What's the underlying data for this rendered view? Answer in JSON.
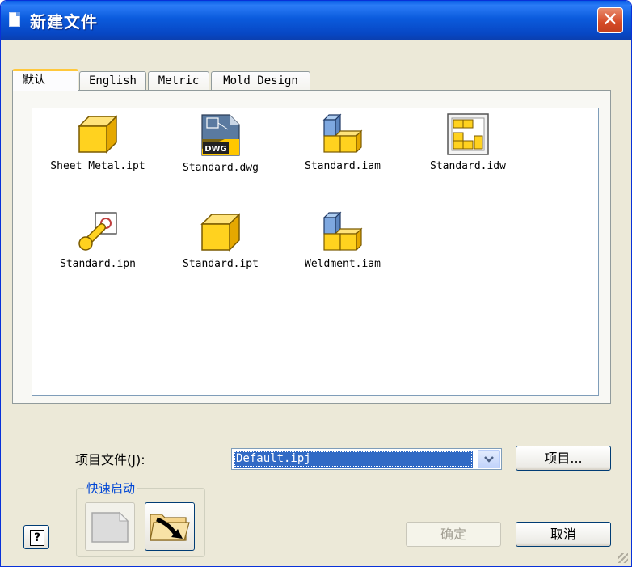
{
  "window": {
    "title": "新建文件",
    "close_glyph": "✕"
  },
  "tabs": [
    "默认",
    "English",
    "Metric",
    "Mold Design"
  ],
  "files": [
    {
      "label": "Sheet Metal.ipt",
      "icon": "part-cube-icon"
    },
    {
      "label": "Standard.dwg",
      "icon": "dwg-drawing-icon"
    },
    {
      "label": "Standard.iam",
      "icon": "assembly-icon"
    },
    {
      "label": "Standard.idw",
      "icon": "idw-drawing-icon"
    },
    {
      "label": "Standard.ipn",
      "icon": "presentation-icon"
    },
    {
      "label": "Standard.ipt",
      "icon": "part-cube-icon"
    },
    {
      "label": "Weldment.iam",
      "icon": "assembly-icon"
    }
  ],
  "dwg_badge": "DWG",
  "project": {
    "label": "项目文件(J):",
    "value": "Default.ipj",
    "button": "项目..."
  },
  "quick_launch": {
    "title": "快速启动"
  },
  "buttons": {
    "ok": "确定",
    "cancel": "取消",
    "help": "?"
  },
  "colors": {
    "title_blue": "#0a5ee6",
    "accent_yellow": "#ffc83c",
    "selection": "#316ac5"
  }
}
